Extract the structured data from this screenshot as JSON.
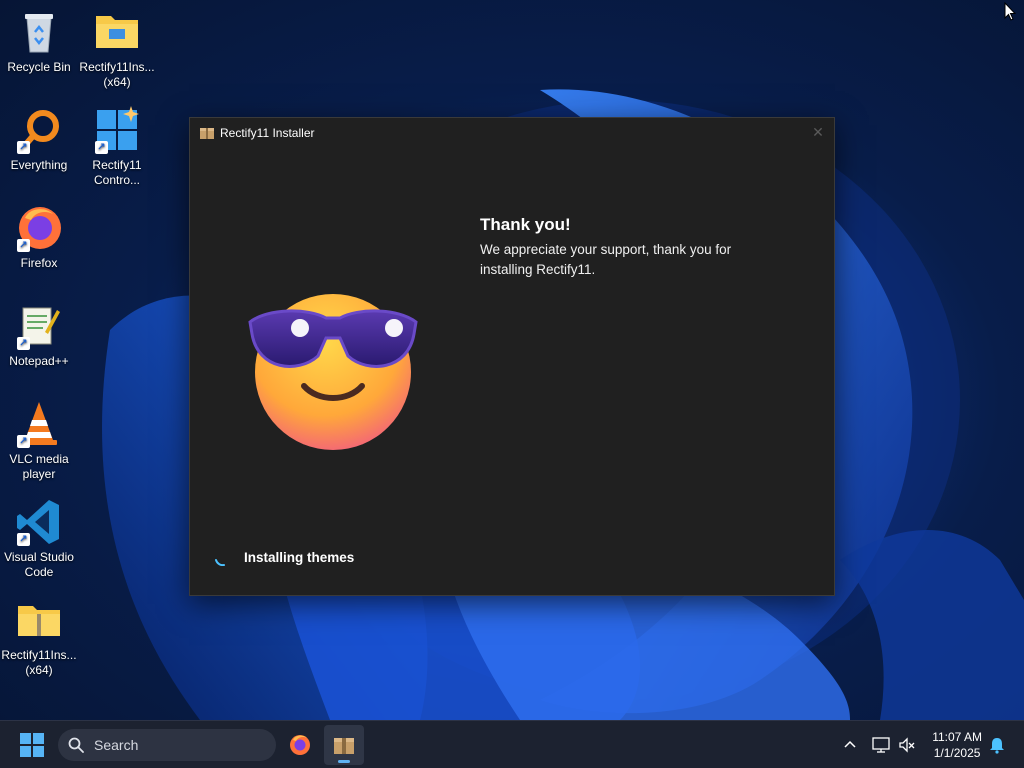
{
  "desktop": {
    "icons": [
      {
        "label": "Recycle Bin"
      },
      {
        "label": "Rectify11Ins... (x64)"
      },
      {
        "label": "Everything"
      },
      {
        "label": "Rectify11 Contro..."
      },
      {
        "label": "Firefox"
      },
      {
        "label": "Notepad++"
      },
      {
        "label": "VLC media player"
      },
      {
        "label": "Visual Studio Code"
      },
      {
        "label": "Rectify11Ins... (x64)"
      }
    ]
  },
  "installer": {
    "title": "Rectify11 Installer",
    "close_icon": "close-icon",
    "heading": "Thank you!",
    "body": "We appreciate your support, thank you for installing Rectify11.",
    "status": "Installing themes",
    "accent": "#4cc2ff"
  },
  "taskbar": {
    "search_label": "Search",
    "time": "11:07 AM",
    "date": "1/1/2025",
    "indicator_color": "#5fb2f2"
  }
}
